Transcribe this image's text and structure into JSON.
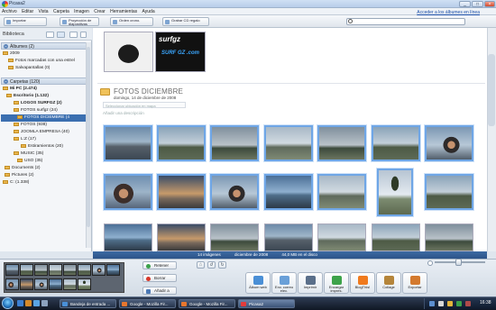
{
  "window": {
    "title": "Picasa2",
    "minimize": "_",
    "maximize": "□",
    "close": "×"
  },
  "menu": {
    "items": [
      "Archivo",
      "Editar",
      "Vista",
      "Carpeta",
      "Imagen",
      "Crear",
      "Herramientas",
      "Ayuda"
    ],
    "account_link": "Acceder a los álbumes en línea"
  },
  "toolbar": {
    "import": "Importar",
    "slideshow": "Proyección de diapositivas",
    "timeline": "Orden crono.",
    "burn_cd": "Grabar CD regalo"
  },
  "search": {
    "placeholder": ""
  },
  "sidebar": {
    "title": "Biblioteca",
    "albums": {
      "label": "Álbumes (2)"
    },
    "albums_items": [
      {
        "label": "2009",
        "indent": 2
      },
      {
        "label": "Fotos marcadas con una estrel",
        "indent": 8
      },
      {
        "label": "Salvapantallas (0)",
        "indent": 8
      }
    ],
    "folders": {
      "label": "Carpetas (120)"
    },
    "folder_items": [
      {
        "label": "Mi PC (2.474)",
        "indent": 2,
        "bold": true
      },
      {
        "label": "Escritorio (1.132)",
        "indent": 6,
        "bold": true
      },
      {
        "label": "LOGOS SURFGZ (2)",
        "indent": 14,
        "bold": true
      },
      {
        "label": "FOTOS surfgz (24)",
        "indent": 14
      },
      {
        "label": "FOTOS DICIEMBRE (4",
        "indent": 18,
        "selected": true
      },
      {
        "label": "FOTOS (938)",
        "indent": 14
      },
      {
        "label": "JOOMLA EMPRESA (40)",
        "indent": 14
      },
      {
        "label": "L:Z (17)",
        "indent": 14
      },
      {
        "label": "Estiramientos (20)",
        "indent": 22
      },
      {
        "label": "MUSIC (35)",
        "indent": 14
      },
      {
        "label": "USO (35)",
        "indent": 18
      },
      {
        "label": "Documents (2)",
        "indent": 4
      },
      {
        "label": "Pictures (2)",
        "indent": 4
      },
      {
        "label": "C: (1.338)",
        "indent": 2
      }
    ]
  },
  "main": {
    "logos": [
      "surfgz",
      "SURF GZ .com"
    ],
    "folder_title": "FOTOS DICIEMBRE",
    "folder_date": "domingo, 14 de diciembre de 2008",
    "location_placeholder": "Seleccionar ubicación en mapa",
    "description_placeholder": "Añadir una descripción"
  },
  "statusbar": {
    "count": "14 imágenes",
    "date": "diciembre de 2008",
    "size": "44,0 MB en el disco"
  },
  "actions": {
    "hold": "Retener",
    "clear": "Borrar",
    "add_to": "Añadir a",
    "rotate_left": "↺",
    "rotate_right": "↻",
    "star": "☆"
  },
  "bottom_tools": [
    {
      "label": "Álbum web",
      "color": "#4a8fd6"
    },
    {
      "label": "Env. correo elec.",
      "color": "#6aa0d8"
    },
    {
      "label": "Imprimir",
      "color": "#5a6f8a"
    },
    {
      "label": "Encargar impres.",
      "color": "#3da34a"
    },
    {
      "label": "BlogThis!",
      "color": "#f07a1d"
    },
    {
      "label": "Collage",
      "color": "#b5853a"
    },
    {
      "label": "Exportar",
      "color": "#d47a2e"
    }
  ],
  "taskbar": {
    "tasks": [
      {
        "label": "Bandeja de entrada ...",
        "color": "#4a90d8"
      },
      {
        "label": "Google - Mozilla Fir...",
        "color": "#e8772e"
      },
      {
        "label": "Google - Mozilla Fir...",
        "color": "#e8772e"
      },
      {
        "label": "Picasa2",
        "color": "#e33b3b",
        "active": true
      }
    ],
    "clock": "16:38"
  }
}
